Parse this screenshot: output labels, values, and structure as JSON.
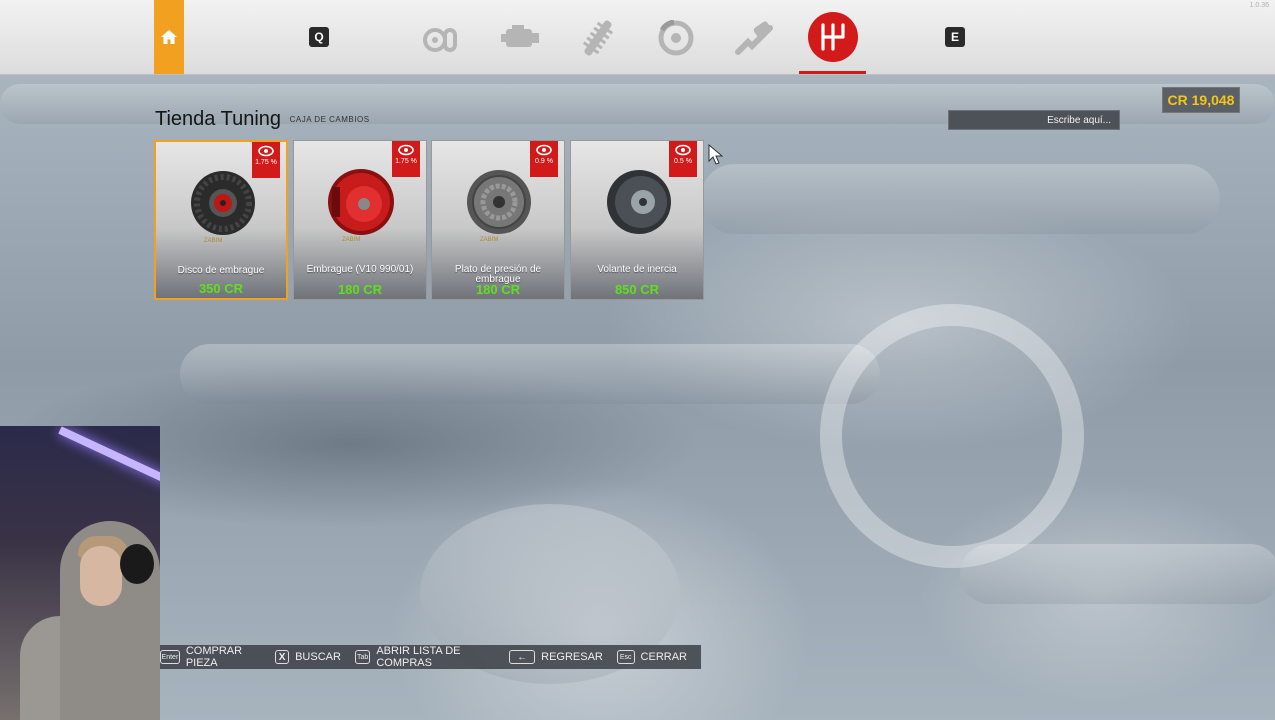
{
  "version": "1.0.36",
  "top_nav": {
    "home_icon": "home-icon",
    "key_left": "Q",
    "key_right": "E",
    "categories": [
      {
        "icon": "turbo-icon",
        "active": false
      },
      {
        "icon": "engine-icon",
        "active": false
      },
      {
        "icon": "suspension-icon",
        "active": false
      },
      {
        "icon": "brake-icon",
        "active": false
      },
      {
        "icon": "exhaust-icon",
        "active": false
      },
      {
        "icon": "gearbox-icon",
        "active": true
      }
    ],
    "accent": "#d21a1a",
    "home_color": "#f2a020"
  },
  "header": {
    "title": "Tienda Tuning",
    "subtitle": "CAJA DE CAMBIOS"
  },
  "credits": "CR 19,048",
  "search": {
    "placeholder": "Escribe aquí..."
  },
  "cards": [
    {
      "name": "Disco de embrague",
      "price": "350 CR",
      "badge": "1.75 %",
      "brand": "ZABIM",
      "selected": true
    },
    {
      "name": "Embrague (V10 990/01)",
      "price": "180 CR",
      "badge": "1.75 %",
      "brand": "ZABIM",
      "selected": false
    },
    {
      "name": "Plato de presión de embrague",
      "price": "180 CR",
      "badge": "0.9 %",
      "brand": "ZABIM",
      "selected": false
    },
    {
      "name": "Volante de inercia",
      "price": "850 CR",
      "badge": "0.5 %",
      "brand": "",
      "selected": false
    }
  ],
  "footer": [
    {
      "key": "Enter",
      "label": "COMPRAR PIEZA"
    },
    {
      "key": "X",
      "label": "BUSCAR"
    },
    {
      "key": "Tab",
      "label": "ABRIR LISTA DE COMPRAS"
    },
    {
      "key": "←",
      "label": "REGRESAR"
    },
    {
      "key": "Esc",
      "label": "CERRAR"
    }
  ]
}
